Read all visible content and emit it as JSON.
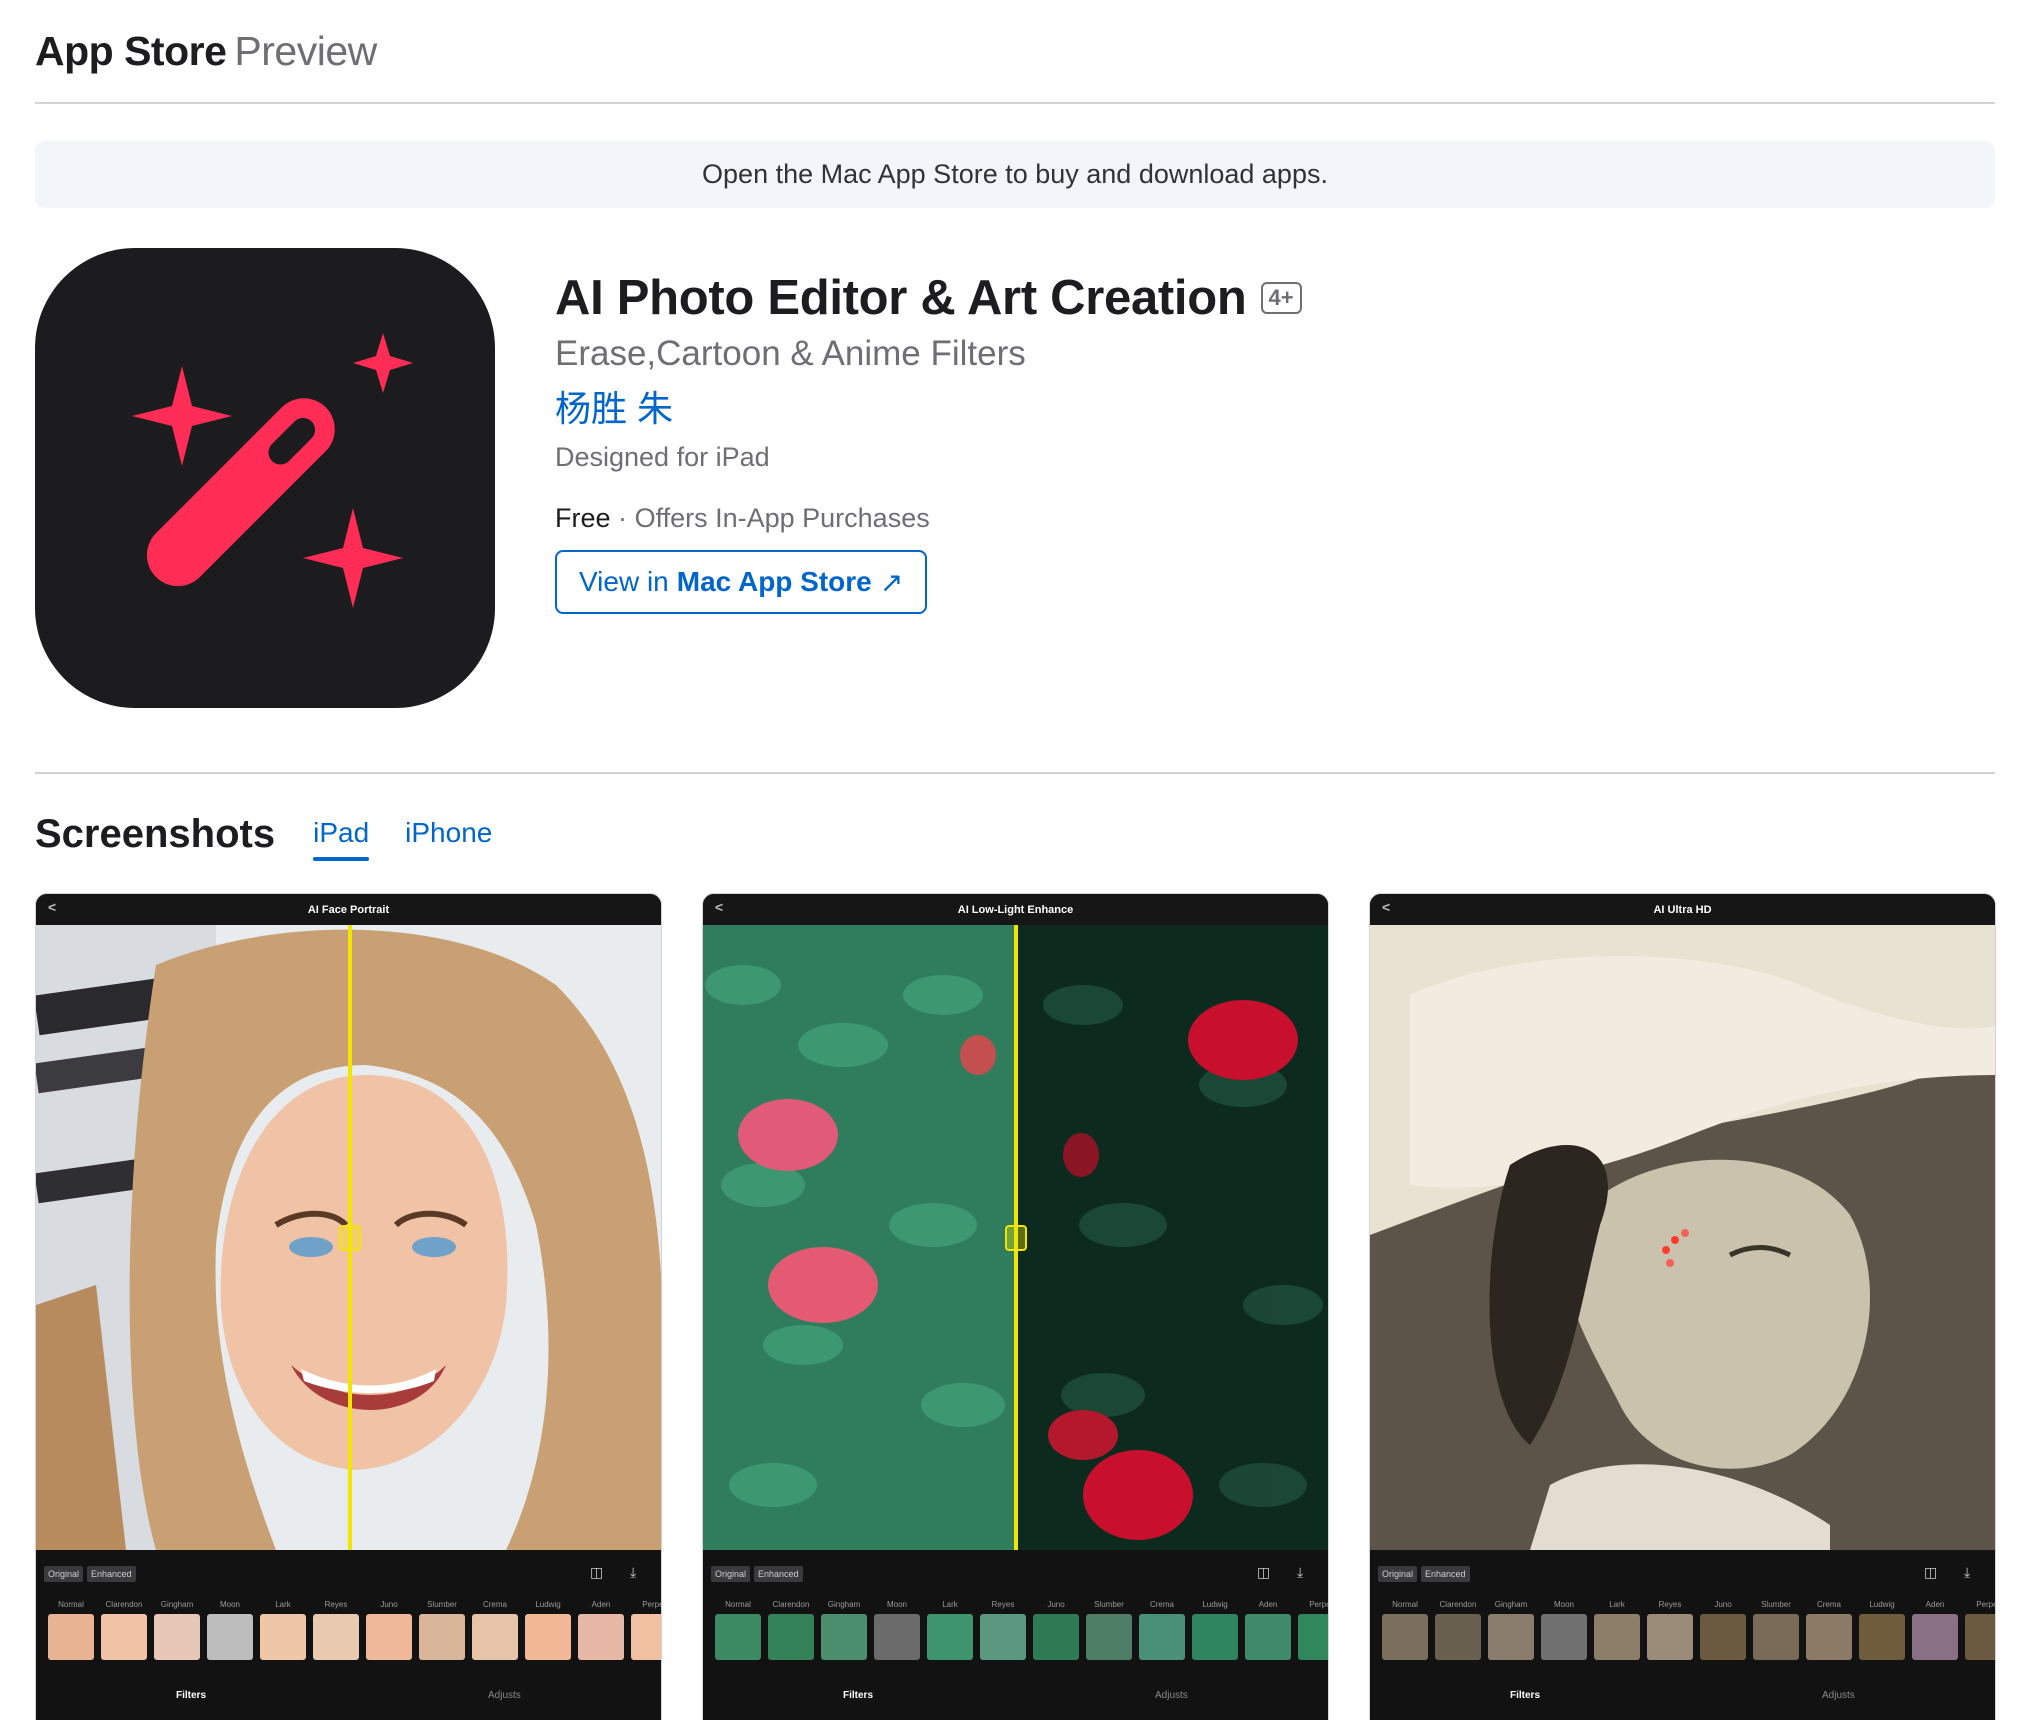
{
  "header": {
    "brand": "App Store",
    "brand_sub": "Preview"
  },
  "banner": {
    "text": "Open the Mac App Store to buy and download apps."
  },
  "app": {
    "title": "AI Photo Editor & Art Creation",
    "age_rating": "4+",
    "subtitle": "Erase,Cartoon & Anime Filters",
    "developer": "杨胜 朱",
    "designed_for": "Designed for iPad",
    "price": "Free",
    "price_sep": "·",
    "iap": "Offers In-App Purchases",
    "view_button": {
      "prefix": "View in",
      "bold": "Mac App Store",
      "arrow": "↗"
    },
    "icon": {
      "name": "magic-wand-icon",
      "background": "#1c1c1e",
      "accent": "#ff2d55"
    }
  },
  "screenshots": {
    "title": "Screenshots",
    "tabs": [
      {
        "label": "iPad",
        "active": true
      },
      {
        "label": "iPhone",
        "active": false
      }
    ],
    "items": [
      {
        "title": "AI Face Portrait"
      },
      {
        "title": "AI Low-Light Enhance"
      },
      {
        "title": "AI Ultra HD"
      }
    ],
    "toggle": [
      "Original",
      "Enhanced"
    ],
    "filter_names": [
      "Normal",
      "Clarendon",
      "Gingham",
      "Moon",
      "Lark",
      "Reyes",
      "Juno",
      "Slumber",
      "Crema",
      "Ludwig",
      "Aden",
      "Perpet"
    ],
    "bottom_tabs": [
      "Filters",
      "Adjusts"
    ],
    "back": "<",
    "compare_icon": "◫",
    "download_icon": "⤓"
  }
}
